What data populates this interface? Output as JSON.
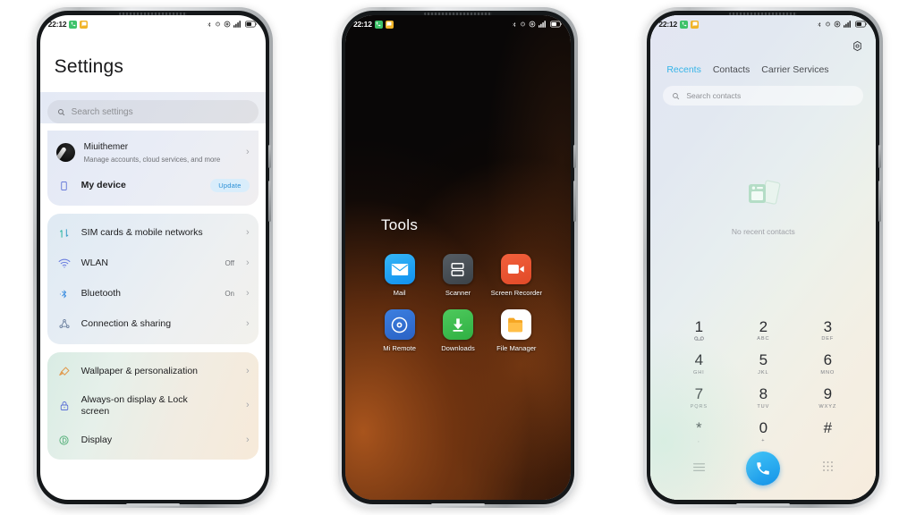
{
  "background_color": "#ffffff",
  "phones": [
    {
      "name": "settings-phone",
      "statusbar": {
        "time": "22:12",
        "badges": [
          "phone-badge",
          "message-badge"
        ],
        "right_icons": [
          "bluetooth-icon",
          "alarm-icon",
          "location-icon",
          "signal-icon",
          "battery-icon"
        ]
      },
      "screen": {
        "title": "Settings",
        "search": {
          "placeholder": "Search settings",
          "icon": "search-icon"
        },
        "groups": [
          {
            "id": "account-group",
            "items": [
              {
                "key": "account",
                "label": "Miuithemer",
                "sub": "Manage accounts, cloud services, and more",
                "icon": "avatar",
                "value": "",
                "chevron": "›"
              },
              {
                "key": "my-device",
                "label": "My device",
                "sub": "",
                "icon": "phone-outline-icon",
                "badge": "Update",
                "chevron": ""
              }
            ]
          },
          {
            "id": "connectivity-group",
            "items": [
              {
                "key": "sim-cards",
                "label": "SIM cards & mobile networks",
                "icon": "sim-signal-icon",
                "value": "",
                "chevron": "›"
              },
              {
                "key": "wlan",
                "label": "WLAN",
                "icon": "wifi-icon",
                "value": "Off",
                "chevron": "›"
              },
              {
                "key": "bluetooth",
                "label": "Bluetooth",
                "icon": "bluetooth-icon",
                "value": "On",
                "chevron": "›"
              },
              {
                "key": "connection-sharing",
                "label": "Connection & sharing",
                "icon": "share-icon",
                "value": "",
                "chevron": "›"
              }
            ]
          },
          {
            "id": "personalization-group",
            "items": [
              {
                "key": "wallpaper",
                "label": "Wallpaper & personalization",
                "icon": "brush-icon",
                "value": "",
                "chevron": "›"
              },
              {
                "key": "always-on-display",
                "label": "Always-on display & Lock screen",
                "icon": "lock-icon",
                "value": "",
                "chevron": "›"
              },
              {
                "key": "display",
                "label": "Display",
                "icon": "display-icon",
                "value": "",
                "chevron": "›"
              }
            ]
          }
        ]
      }
    },
    {
      "name": "home-phone",
      "statusbar": {
        "time": "22:12",
        "badges": [
          "phone-badge",
          "message-badge"
        ],
        "right_icons": [
          "bluetooth-icon",
          "alarm-icon",
          "location-icon",
          "signal-icon",
          "battery-icon"
        ]
      },
      "screen": {
        "folder_title": "Tools",
        "apps": [
          {
            "name": "Mail",
            "icon": "mail-icon",
            "class": "ic-mail"
          },
          {
            "name": "Scanner",
            "icon": "scanner-icon",
            "class": "ic-scanner"
          },
          {
            "name": "Screen Recorder",
            "icon": "video-camera-icon",
            "class": "ic-screenrec"
          },
          {
            "name": "Mi Remote",
            "icon": "remote-icon",
            "class": "ic-remote"
          },
          {
            "name": "Downloads",
            "icon": "download-arrow-icon",
            "class": "ic-downloads"
          },
          {
            "name": "File Manager",
            "icon": "folder-icon",
            "class": "ic-filemgr"
          }
        ]
      }
    },
    {
      "name": "dialer-phone",
      "statusbar": {
        "time": "22:12",
        "badges": [
          "phone-badge",
          "message-badge"
        ],
        "right_icons": [
          "bluetooth-icon",
          "alarm-icon",
          "location-icon",
          "signal-icon",
          "battery-icon"
        ]
      },
      "screen": {
        "settings_icon": "gear-icon",
        "tabs": [
          {
            "label": "Recents",
            "active": true
          },
          {
            "label": "Contacts",
            "active": false
          },
          {
            "label": "Carrier Services",
            "active": false
          }
        ],
        "accent_color": "#35b4e8",
        "search": {
          "placeholder": "Search contacts",
          "icon": "search-icon"
        },
        "empty_state": {
          "icon": "no-contacts-icon",
          "label": "No recent contacts"
        },
        "keys": [
          {
            "num": "1",
            "sub": "voicemail-icon"
          },
          {
            "num": "2",
            "sub": "ABC"
          },
          {
            "num": "3",
            "sub": "DEF"
          },
          {
            "num": "4",
            "sub": "GHI"
          },
          {
            "num": "5",
            "sub": "JKL"
          },
          {
            "num": "6",
            "sub": "MNO"
          },
          {
            "num": "7",
            "sub": "PQRS"
          },
          {
            "num": "8",
            "sub": "TUV"
          },
          {
            "num": "9",
            "sub": "WXYZ"
          },
          {
            "num": "*",
            "sub": ","
          },
          {
            "num": "0",
            "sub": "+"
          },
          {
            "num": "#",
            "sub": ""
          }
        ],
        "actions": [
          {
            "key": "menu",
            "icon": "menu-lines-icon"
          },
          {
            "key": "call",
            "icon": "call-icon",
            "color": "#1593e8"
          },
          {
            "key": "keypad",
            "icon": "keypad-dots-icon"
          }
        ]
      }
    }
  ]
}
